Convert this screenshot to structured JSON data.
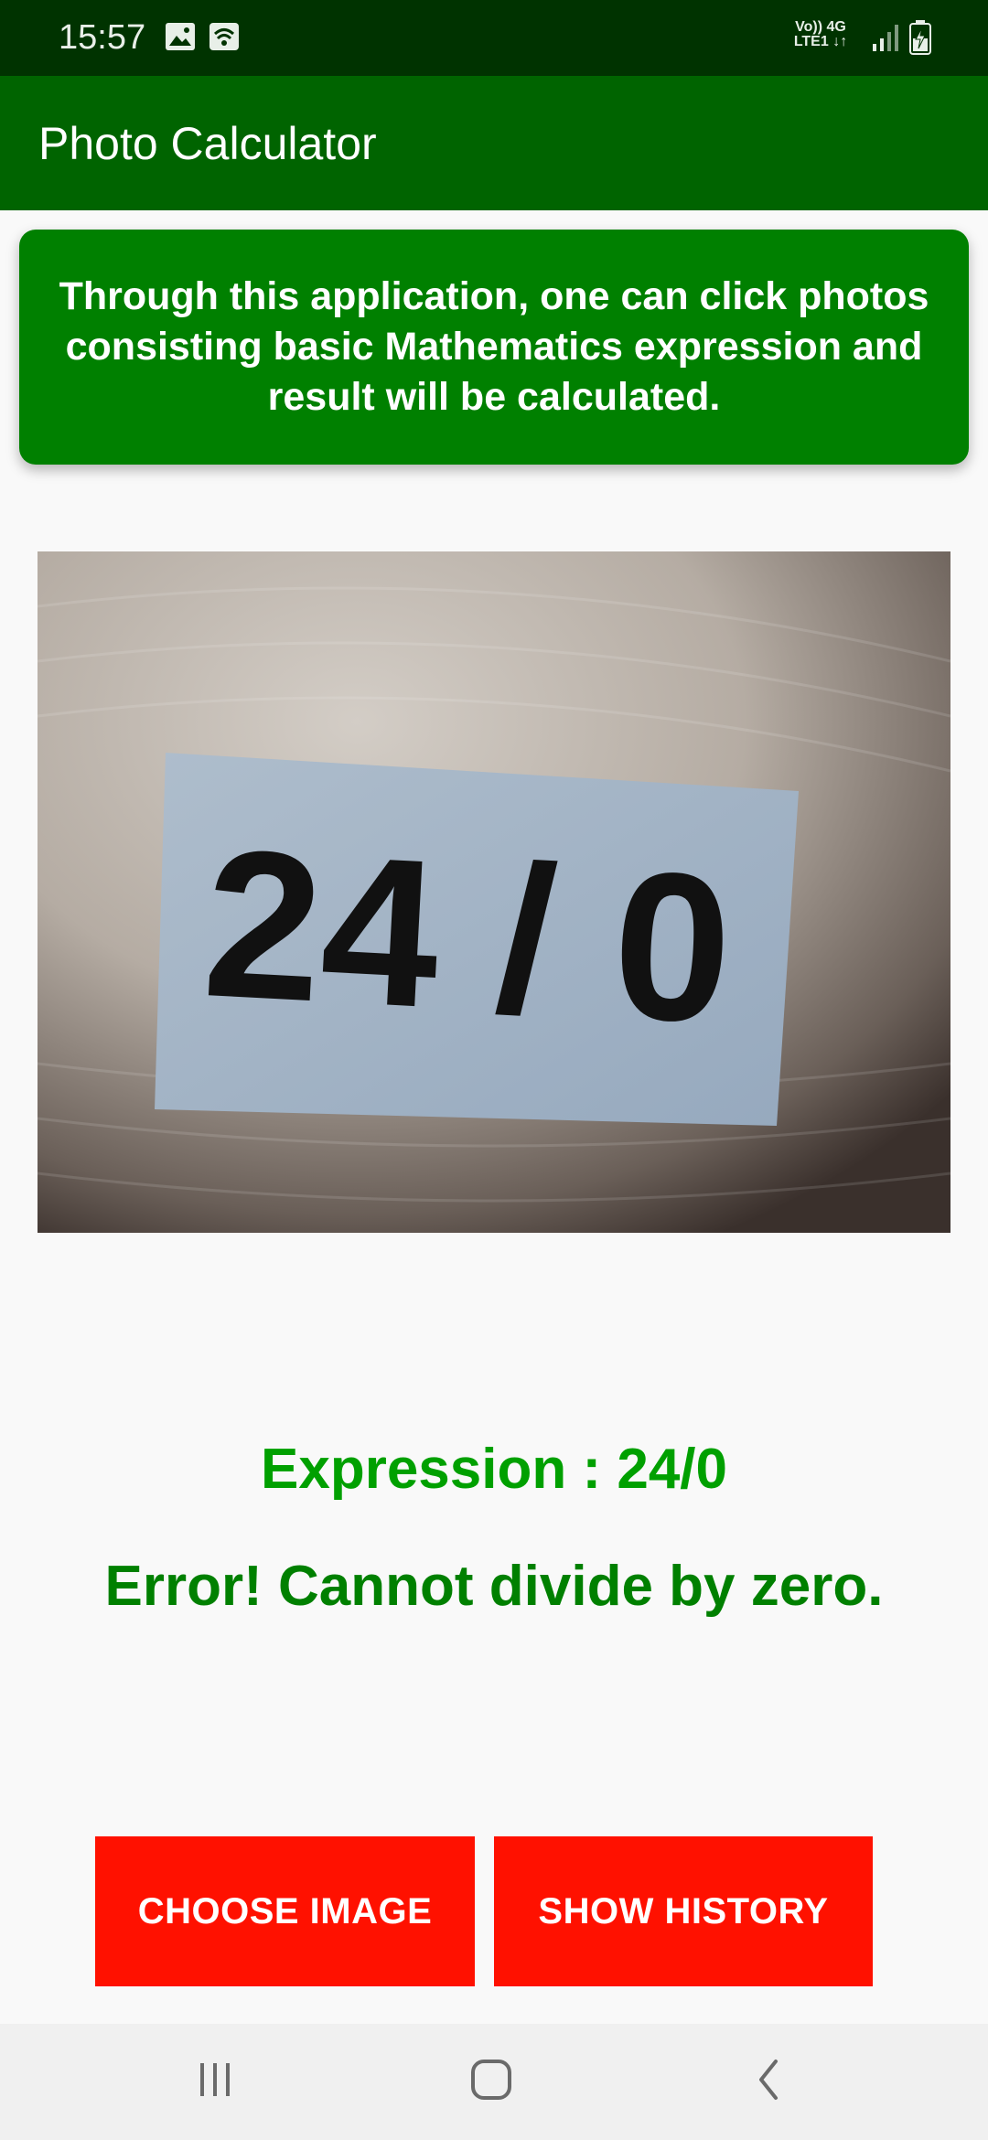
{
  "status_bar": {
    "time": "15:57",
    "network_top": "Vo)) 4G",
    "network_bottom": "LTE1 ↓↑",
    "icons": [
      "gallery-icon",
      "wifi-calling-icon",
      "signal-icon",
      "battery-charging-icon"
    ]
  },
  "app_bar": {
    "title": "Photo Calculator"
  },
  "info_card": {
    "text": "Through this application, one can click photos consisting basic Mathematics expression and result will be calculated."
  },
  "photo": {
    "content": "24 / 0"
  },
  "result": {
    "expression_label": "Expression : 24/0",
    "message": "Error! Cannot divide by zero."
  },
  "buttons": {
    "choose_image": "CHOOSE IMAGE",
    "show_history": "SHOW HISTORY"
  },
  "nav_bar": {
    "icons": [
      "recent-apps-icon",
      "home-icon",
      "back-icon"
    ]
  },
  "colors": {
    "status_bar": "#003300",
    "app_bar": "#006400",
    "info_card": "#008000",
    "expression": "#00a000",
    "result": "#008000",
    "buttons": "#ff1100"
  }
}
